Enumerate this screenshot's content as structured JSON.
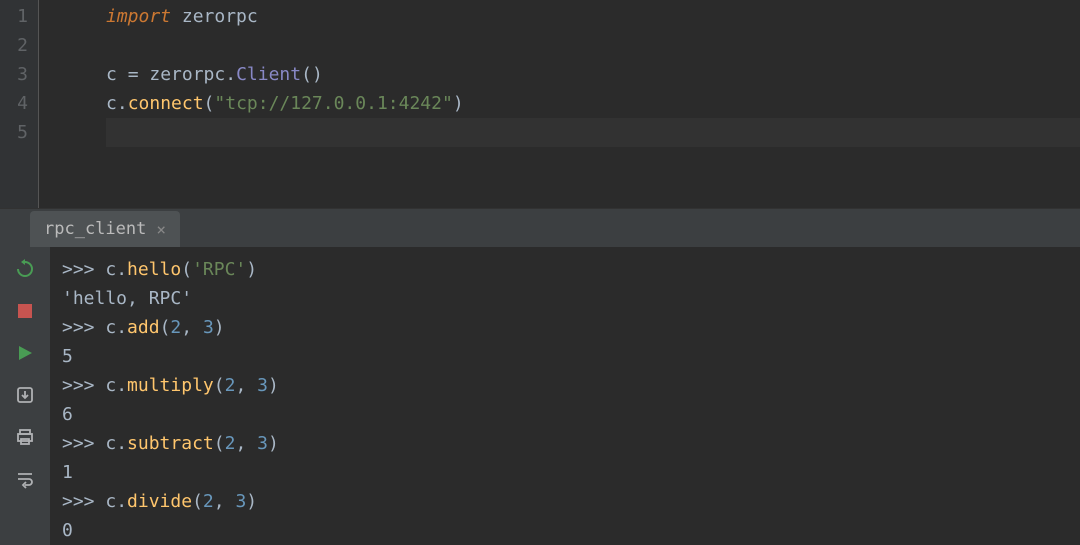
{
  "editor": {
    "line_numbers": [
      "1",
      "2",
      "3",
      "4",
      "5"
    ],
    "tokens": {
      "l1_import": "import",
      "l1_module": "zerorpc",
      "l3_var": "c",
      "l3_eq": "=",
      "l3_module": "zerorpc",
      "l3_dot": ".",
      "l3_class": "Client",
      "l3_parens": "()",
      "l4_var": "c",
      "l4_dot": ".",
      "l4_method": "connect",
      "l4_open": "(",
      "l4_str": "\"tcp://127.0.0.1:4242\"",
      "l4_close": ")"
    }
  },
  "console": {
    "tab_label": "rpc_client",
    "prompt": ">>>",
    "lines": {
      "l1_obj": "c",
      "l1_dot": ".",
      "l1_method": "hello",
      "l1_open": "(",
      "l1_arg": "'RPC'",
      "l1_close": ")",
      "r1": "'hello, RPC'",
      "l2_obj": "c",
      "l2_method": "add",
      "l2_args_open": "(",
      "l2_a1": "2",
      "l2_comma": ", ",
      "l2_a2": "3",
      "l2_close": ")",
      "r2": "5",
      "l3_obj": "c",
      "l3_method": "multiply",
      "l3_a1": "2",
      "l3_a2": "3",
      "r3": "6",
      "l4_obj": "c",
      "l4_method": "subtract",
      "l4_a1": "2",
      "l4_a2": "3",
      "r4": "1",
      "l5_obj": "c",
      "l5_method": "divide",
      "l5_a1": "2",
      "l5_a2": "3",
      "r5": "0"
    }
  },
  "toolbar_icons": {
    "rerun": "rerun-icon",
    "stop": "stop-icon",
    "play": "play-icon",
    "download": "download-icon",
    "print": "print-icon",
    "wrap": "wrap-icon"
  }
}
